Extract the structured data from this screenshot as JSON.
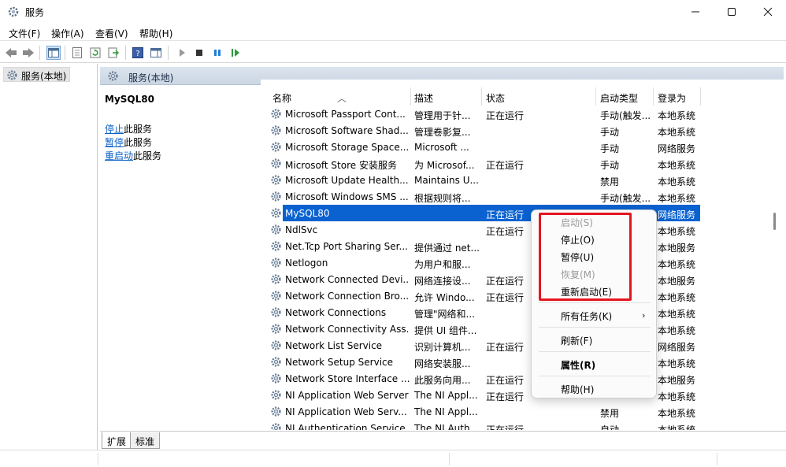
{
  "window": {
    "title": "服务"
  },
  "menu": [
    "文件(F)",
    "操作(A)",
    "查看(V)",
    "帮助(H)"
  ],
  "tree": {
    "root": "服务(本地)"
  },
  "header": {
    "title": "服务(本地)"
  },
  "detail": {
    "service_name": "MySQL80",
    "actions": [
      {
        "link": "停止",
        "rest": "此服务"
      },
      {
        "link": "暂停",
        "rest": "此服务"
      },
      {
        "link": "重启动",
        "rest": "此服务"
      }
    ]
  },
  "columns": [
    "名称",
    "描述",
    "状态",
    "启动类型",
    "登录为"
  ],
  "rows": [
    {
      "name": "Microsoft Passport Cont...",
      "desc": "管理用于针...",
      "status": "正在运行",
      "startup": "手动(触发...",
      "logon": "本地系统"
    },
    {
      "name": "Microsoft Software Shad...",
      "desc": "管理卷影复...",
      "status": "",
      "startup": "手动",
      "logon": "本地系统"
    },
    {
      "name": "Microsoft Storage Space...",
      "desc": "Microsoft ...",
      "status": "",
      "startup": "手动",
      "logon": "网络服务"
    },
    {
      "name": "Microsoft Store 安装服务",
      "desc": "为 Microsof...",
      "status": "正在运行",
      "startup": "手动",
      "logon": "本地系统"
    },
    {
      "name": "Microsoft Update Health...",
      "desc": "Maintains U...",
      "status": "",
      "startup": "禁用",
      "logon": "本地系统"
    },
    {
      "name": "Microsoft Windows SMS ...",
      "desc": "根据规则将...",
      "status": "",
      "startup": "手动(触发...",
      "logon": "本地系统"
    },
    {
      "name": "MySQL80",
      "desc": "",
      "status": "正在运行",
      "startup": "",
      "logon": "网络服务",
      "selected": true
    },
    {
      "name": "NdlSvc",
      "desc": "",
      "status": "正在运行",
      "startup": "",
      "logon": "本地系统"
    },
    {
      "name": "Net.Tcp Port Sharing Ser...",
      "desc": "提供通过 net...",
      "status": "",
      "startup": "",
      "logon": "本地服务"
    },
    {
      "name": "Netlogon",
      "desc": "为用户和服...",
      "status": "",
      "startup": "",
      "logon": "本地系统"
    },
    {
      "name": "Network Connected Devi...",
      "desc": "网络连接设...",
      "status": "正在运行",
      "startup": "",
      "logon": "本地服务"
    },
    {
      "name": "Network Connection Bro...",
      "desc": "允许 Windo...",
      "status": "正在运行",
      "startup": "",
      "logon": "本地系统"
    },
    {
      "name": "Network Connections",
      "desc": "管理\"网络和...",
      "status": "",
      "startup": "",
      "logon": "本地系统"
    },
    {
      "name": "Network Connectivity Ass...",
      "desc": "提供 UI 组件...",
      "status": "",
      "startup": "",
      "logon": "本地系统"
    },
    {
      "name": "Network List Service",
      "desc": "识别计算机...",
      "status": "正在运行",
      "startup": "",
      "logon": "网络服务"
    },
    {
      "name": "Network Setup Service",
      "desc": "网络安装服...",
      "status": "",
      "startup": "",
      "logon": "本地系统"
    },
    {
      "name": "Network Store Interface ...",
      "desc": "此服务向用...",
      "status": "正在运行",
      "startup": "",
      "logon": "本地服务"
    },
    {
      "name": "NI Application Web Server",
      "desc": "The NI Appl...",
      "status": "正在运行",
      "startup": "",
      "logon": "本地系统"
    },
    {
      "name": "NI Application Web Serv...",
      "desc": "The NI Appl...",
      "status": "",
      "startup": "禁用",
      "logon": "本地系统"
    },
    {
      "name": "NI Authentication Service",
      "desc": "The NI Auth...",
      "status": "正在运行",
      "startup": "自动",
      "logon": "本地系统"
    }
  ],
  "context_menu": {
    "items": [
      {
        "label": "启动(S)",
        "disabled": true
      },
      {
        "label": "停止(O)"
      },
      {
        "label": "暂停(U)"
      },
      {
        "label": "恢复(M)",
        "disabled": true
      },
      {
        "label": "重新启动(E)"
      },
      {
        "label": "所有任务(K)",
        "submenu": true
      },
      {
        "label": "刷新(F)"
      },
      {
        "label": "属性(R)",
        "bold": true
      },
      {
        "label": "帮助(H)"
      }
    ]
  },
  "tabs": [
    "扩展",
    "标准"
  ],
  "colors": {
    "selection": "#0a62d0",
    "highlight_box": "#e5151e",
    "link": "#0b5fc7"
  }
}
